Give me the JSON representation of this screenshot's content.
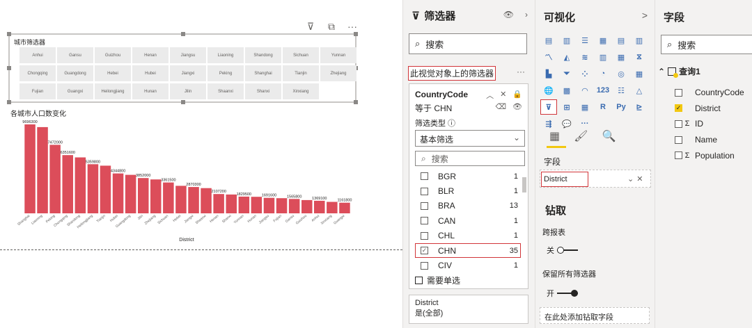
{
  "canvas": {
    "header_icons": [
      "filter-icon",
      "focus-mode-icon",
      "more-options-icon"
    ],
    "header_glyphs": [
      "⊽",
      "⧉",
      "···"
    ],
    "slicer": {
      "title": "城市筛选器",
      "tiles": [
        "Anhui",
        "Gansu",
        "Guizhou",
        "Henan",
        "Jiangsu",
        "Liaoning",
        "Shandong",
        "Sichuan",
        "Yunnan",
        "Chongqing",
        "Guangdong",
        "Hebei",
        "Hubei",
        "Jiangxi",
        "Peking",
        "Shanghai",
        "Tianjin",
        "Zhejiang",
        "Fujian",
        "Guangxi",
        "Heilongjiang",
        "Hunan",
        "Jilin",
        "Shaanxi",
        "Shanxi",
        "Xinxiang"
      ]
    }
  },
  "chart_data": {
    "type": "bar",
    "title": "各城市人口数变化",
    "xlabel": "District",
    "ylabel": "",
    "bar_color": "#dc4d5a",
    "categories": [
      "Shanghai",
      "Liaoning",
      "Peking",
      "Chongqing",
      "Shandong",
      "Heilongjiang",
      "Tianjin",
      "Hubei",
      "Guangdong",
      "Jilin",
      "Zhejiang",
      "Sichuan",
      "Hebei",
      "Jiangxi",
      "Shaanxi",
      "Henan",
      "Shanxi",
      "Yunnan",
      "Hunan",
      "Jiangsu",
      "Fujian",
      "Gansu",
      "Guizhou",
      "Anhui",
      "Xinxiang",
      "Guangxi"
    ],
    "values": [
      9696300,
      9400000,
      7472000,
      6351600,
      6100000,
      5359800,
      5200000,
      4344800,
      4200000,
      3852000,
      3700000,
      3361500,
      3000000,
      2870300,
      2750000,
      2107200,
      2050000,
      1829500,
      1800000,
      1691600,
      1650000,
      1565800,
      1450000,
      1369100,
      1250000,
      1161800
    ],
    "data_labels": [
      "9696300",
      "",
      "7472000",
      "6351600",
      "",
      "5359800",
      "",
      "4344800",
      "",
      "3852000",
      "",
      "3361500",
      "",
      "2870300",
      "",
      "2107200",
      "",
      "1829500",
      "",
      "1691600",
      "",
      "1565800",
      "",
      "1369100",
      "",
      "1161800"
    ],
    "ylim": [
      0,
      10000000
    ]
  },
  "filters": {
    "header": "筛选器",
    "search_placeholder": "搜索",
    "section_title": "此视觉对象上的筛选器",
    "section_more": "···",
    "country_card": {
      "field": "CountryCode",
      "condition": "等于 CHN",
      "type_label": "筛选类型 ⓘ",
      "type_value": "基本筛选",
      "search_placeholder": "搜索",
      "items": [
        {
          "name": "BGR",
          "count": "1",
          "checked": false
        },
        {
          "name": "BLR",
          "count": "1",
          "checked": false
        },
        {
          "name": "BRA",
          "count": "13",
          "checked": false
        },
        {
          "name": "CAN",
          "count": "1",
          "checked": false
        },
        {
          "name": "CHL",
          "count": "1",
          "checked": false
        },
        {
          "name": "CHN",
          "count": "35",
          "checked": true
        },
        {
          "name": "CIV",
          "count": "1",
          "checked": false
        }
      ],
      "single_select_label": "需要单选"
    },
    "district_card": {
      "field": "District",
      "condition": "是(全部)"
    }
  },
  "viz": {
    "header": "可视化",
    "chevron": ">",
    "icons": [
      {
        "name": "stacked-bar-chart-icon",
        "glyph": "▤"
      },
      {
        "name": "stacked-column-chart-icon",
        "glyph": "▥"
      },
      {
        "name": "clustered-bar-chart-icon",
        "glyph": "☰"
      },
      {
        "name": "clustered-column-chart-icon",
        "glyph": "▦"
      },
      {
        "name": "100-bar-chart-icon",
        "glyph": "▤"
      },
      {
        "name": "100-column-chart-icon",
        "glyph": "▥"
      },
      {
        "name": "line-chart-icon",
        "glyph": "〽"
      },
      {
        "name": "area-chart-icon",
        "glyph": "◭"
      },
      {
        "name": "stacked-area-chart-icon",
        "glyph": "≋"
      },
      {
        "name": "line-column-chart-icon",
        "glyph": "▥"
      },
      {
        "name": "line-clustered-column-icon",
        "glyph": "▦"
      },
      {
        "name": "ribbon-chart-icon",
        "glyph": "⧖"
      },
      {
        "name": "waterfall-chart-icon",
        "glyph": "▙"
      },
      {
        "name": "funnel-chart-icon",
        "glyph": "⏷"
      },
      {
        "name": "scatter-chart-icon",
        "glyph": "⁘"
      },
      {
        "name": "pie-chart-icon",
        "glyph": "◔"
      },
      {
        "name": "donut-chart-icon",
        "glyph": "◎"
      },
      {
        "name": "treemap-icon",
        "glyph": "▦"
      },
      {
        "name": "map-icon",
        "glyph": "🌐"
      },
      {
        "name": "filled-map-icon",
        "glyph": "▩"
      },
      {
        "name": "gauge-icon",
        "glyph": "◠"
      },
      {
        "name": "card-icon",
        "glyph": "123"
      },
      {
        "name": "multi-row-card-icon",
        "glyph": "☷"
      },
      {
        "name": "kpi-icon",
        "glyph": "△"
      },
      {
        "name": "slicer-icon",
        "glyph": "⊽"
      },
      {
        "name": "table-icon",
        "glyph": "⊞"
      },
      {
        "name": "matrix-icon",
        "glyph": "▦"
      },
      {
        "name": "r-visual-icon",
        "glyph": "R"
      },
      {
        "name": "python-visual-icon",
        "glyph": "Py"
      },
      {
        "name": "key-influencers-icon",
        "glyph": "⊵"
      },
      {
        "name": "decomposition-tree-icon",
        "glyph": "⇶"
      },
      {
        "name": "qa-icon",
        "glyph": "💬"
      },
      {
        "name": "more-visuals-icon",
        "glyph": "···"
      }
    ],
    "tab_icons": [
      {
        "name": "fields-tab-icon",
        "glyph": "▦"
      },
      {
        "name": "format-tab-icon",
        "glyph": "🖌"
      },
      {
        "name": "analytics-tab-icon",
        "glyph": "🔍"
      }
    ],
    "fields_label": "字段",
    "field_chip": "District",
    "drill_title": "钻取",
    "cross_report_label": "跨报表",
    "cross_report_state": "关",
    "keep_filters_label": "保留所有筛选器",
    "keep_filters_state": "开",
    "drill_well_placeholder": "在此处添加钻取字段"
  },
  "fields": {
    "header": "字段",
    "search_placeholder": "搜索",
    "table_name": "查询1",
    "items": [
      {
        "name": "CountryCode",
        "checked": false,
        "sigma": false
      },
      {
        "name": "District",
        "checked": true,
        "sigma": false
      },
      {
        "name": "ID",
        "checked": false,
        "sigma": true
      },
      {
        "name": "Name",
        "checked": false,
        "sigma": false
      },
      {
        "name": "Population",
        "checked": false,
        "sigma": true
      }
    ]
  }
}
